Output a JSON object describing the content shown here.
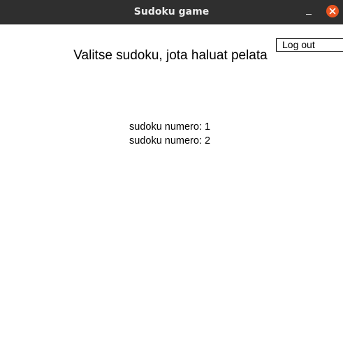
{
  "window": {
    "title": "Sudoku game"
  },
  "header": {
    "logout_label": "Log out",
    "heading": "Valitse sudoku, jota haluat pelata"
  },
  "sudokus": [
    {
      "label": "sudoku numero: 1"
    },
    {
      "label": "sudoku numero: 2"
    }
  ],
  "icons": {
    "minimize": "minimize-icon",
    "close": "close-icon"
  },
  "colors": {
    "titlebar": "#2f2f2f",
    "close_button": "#e95420",
    "background": "#ffffff"
  }
}
